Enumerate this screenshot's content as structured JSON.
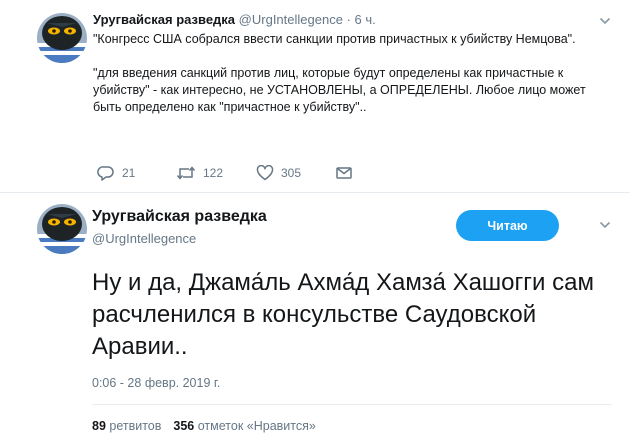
{
  "tweet1": {
    "display_name": "Уругвайская разведка",
    "handle": "@UrgIntellegence",
    "separator": "·",
    "time": "6 ч.",
    "paragraphs": [
      "\"Конгресс США собрался ввести санкции против причастных к убийству Немцова\".",
      "\"для введения санкций против лиц, которые будут определены как причастные к убийству\" - как интересно, не УСТАНОВЛЕНЫ, а ОПРЕДЕЛЕНЫ. Любое лицо может быть определено как \"причастное к убийству\".."
    ],
    "actions": {
      "reply_count": "21",
      "retweet_count": "122",
      "like_count": "305"
    }
  },
  "tweet2": {
    "display_name": "Уругвайская разведка",
    "handle": "@UrgIntellegence",
    "follow_label": "Читаю",
    "text": "Ну и да, Джама́ль Ахма́д Хамза́ Хашогги сам расчленился в консульстве Саудовской Аравии..",
    "timestamp": "0:06 - 28 февр. 2019 г.",
    "stats": {
      "retweets_count": "89",
      "retweets_label": "ретвитов",
      "likes_count": "356",
      "likes_label": "отметок «Нравится»"
    }
  },
  "colors": {
    "accent": "#1da1f2",
    "secondary_text": "#657786",
    "divider": "#e6ecf0"
  },
  "icons": [
    "avatar",
    "chevron-down-icon",
    "reply-icon",
    "retweet-icon",
    "like-icon",
    "direct-message-icon"
  ]
}
